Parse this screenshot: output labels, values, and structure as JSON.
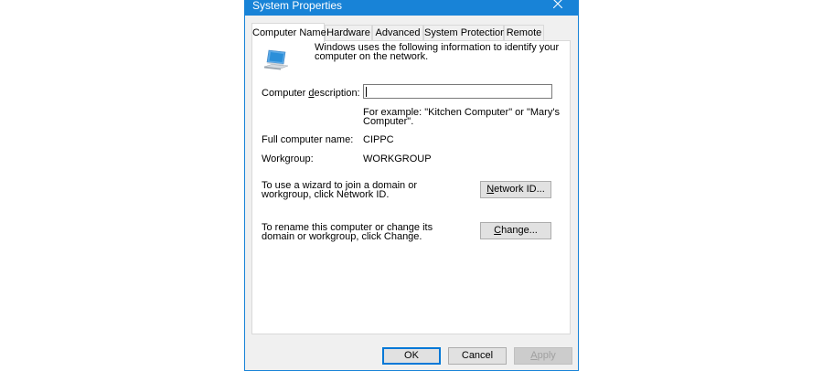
{
  "window": {
    "title": "System Properties",
    "close_glyph": "✕"
  },
  "tabs": [
    {
      "label": "Computer Name",
      "active": true
    },
    {
      "label": "Hardware",
      "active": false
    },
    {
      "label": "Advanced",
      "active": false
    },
    {
      "label": "System Protection",
      "active": false
    },
    {
      "label": "Remote",
      "active": false
    }
  ],
  "computer_name": {
    "info_text": "Windows uses the following information to identify your computer on the network.",
    "description_label_pre": "Computer ",
    "description_label_key": "d",
    "description_label_post": "escription:",
    "description_value": "",
    "example_text": "For example: \"Kitchen Computer\" or \"Mary's Computer\".",
    "full_name_label": "Full computer name:",
    "full_name_value": "CIPPC",
    "workgroup_label": "Workgroup:",
    "workgroup_value": "WORKGROUP",
    "network_id_text": "To use a wizard to join a domain or workgroup, click Network ID.",
    "network_id_button_key": "N",
    "network_id_button_rest": "etwork ID...",
    "rename_text": "To rename this computer or change its domain or workgroup, click Change.",
    "change_button_key": "C",
    "change_button_rest": "hange..."
  },
  "footer": {
    "ok_label": "OK",
    "cancel_label": "Cancel",
    "apply_key": "A",
    "apply_rest": "pply"
  },
  "colors": {
    "titlebar": "#1883d7",
    "dialog_bg": "#f0f0f0",
    "monitor_screen": "#2b8fd9"
  },
  "icons": {
    "computer": "computer-icon",
    "close": "close-icon"
  }
}
